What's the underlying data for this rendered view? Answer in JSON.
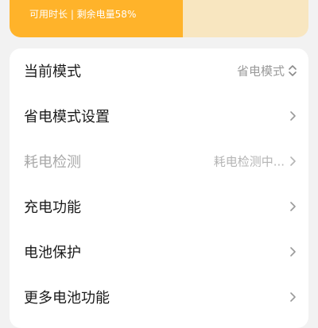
{
  "battery": {
    "status_text": "可用时长 | 剩余电量58%",
    "level_percent": 58,
    "fill_color": "#ffb32a",
    "track_color": "#f8e6c0"
  },
  "settings": {
    "items": [
      {
        "label": "当前模式",
        "value": "省电模式",
        "icon": "updown-chevron-icon",
        "enabled": true
      },
      {
        "label": "省电模式设置",
        "icon": "chevron-right-icon",
        "enabled": true
      },
      {
        "label": "耗电检测",
        "value": "耗电检测中...",
        "icon": "chevron-right-icon",
        "enabled": false
      },
      {
        "label": "充电功能",
        "icon": "chevron-right-icon",
        "enabled": true
      },
      {
        "label": "电池保护",
        "icon": "chevron-right-icon",
        "enabled": true
      },
      {
        "label": "更多电池功能",
        "icon": "chevron-right-icon",
        "enabled": true
      }
    ]
  }
}
